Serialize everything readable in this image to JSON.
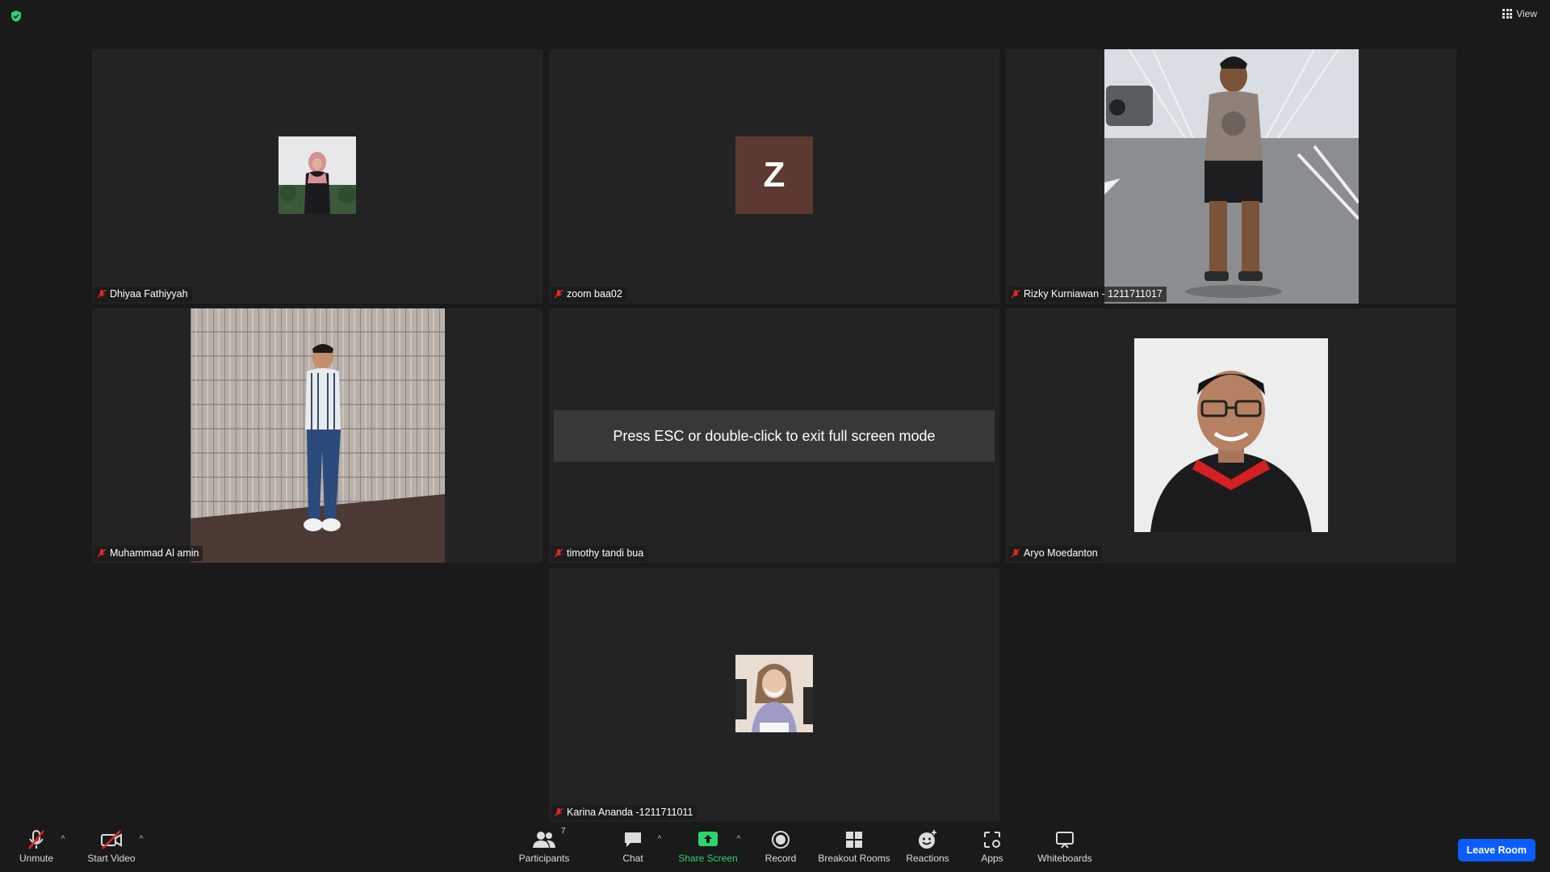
{
  "top": {
    "view_label": "View"
  },
  "tiles": [
    {
      "name": "Dhiyaa Fathiyyah"
    },
    {
      "name": "zoom baa02",
      "initial": "Z"
    },
    {
      "name": "Rizky Kurniawan - 1211711017"
    },
    {
      "name": "Muhammad Al amin"
    },
    {
      "name": "timothy tandi bua"
    },
    {
      "name": "Aryo Moedanton"
    },
    {
      "name": "Karina Ananda -1211711011"
    }
  ],
  "overlay": {
    "esc_message": "Press ESC or double-click to exit full screen mode",
    "watermark": "timothy tandi bua"
  },
  "toolbar": {
    "unmute": "Unmute",
    "start_video": "Start Video",
    "participants": "Participants",
    "participants_count": "7",
    "chat": "Chat",
    "share_screen": "Share Screen",
    "record": "Record",
    "breakout_rooms": "Breakout Rooms",
    "reactions": "Reactions",
    "apps": "Apps",
    "whiteboards": "Whiteboards",
    "leave": "Leave Room"
  },
  "colors": {
    "accent": "#0b5cff",
    "share_green": "#2dd36f",
    "muted_red": "#e02828",
    "letter_avatar_bg": "#5c3a31"
  }
}
